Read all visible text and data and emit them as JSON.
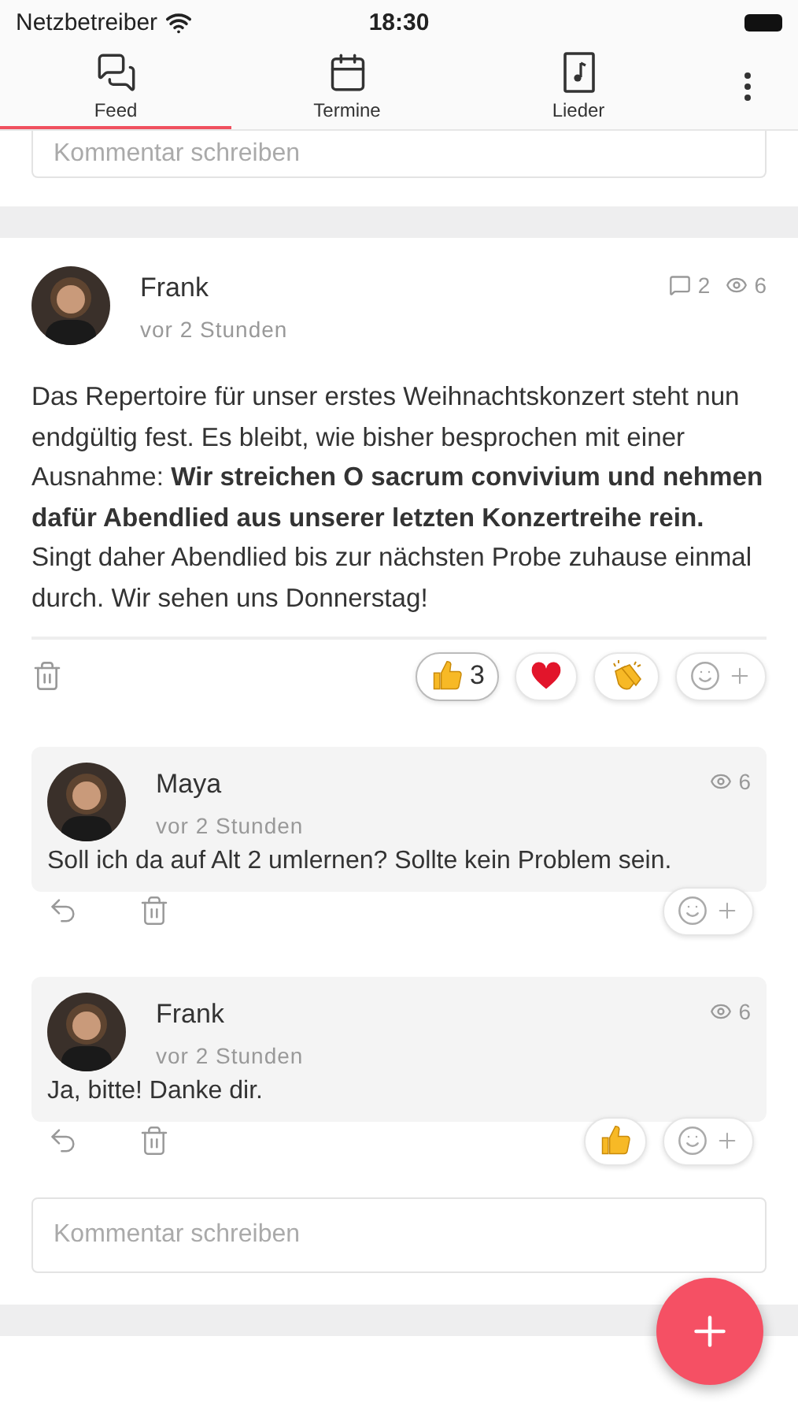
{
  "status_bar": {
    "carrier": "Netzbetreiber",
    "time": "18:30"
  },
  "tabs": [
    {
      "kind": "feed",
      "label": "Feed",
      "selected": true
    },
    {
      "kind": "calendar",
      "label": "Termine",
      "selected": false
    },
    {
      "kind": "songs",
      "label": "Lieder",
      "selected": false
    }
  ],
  "previous_post": {
    "comment_field": {
      "placeholder": "Kommentar schreiben"
    }
  },
  "post": {
    "author": "Frank",
    "time": "vor 2 Stunden",
    "comments": "2",
    "views": "6",
    "body": "Das Repertoire für unser erstes Weihnachtskonzert steht nun endgültig fest. Es bleibt, wie bisher besprochen mit einer Ausnahme: **Wir streichen O sacrum convivium und nehmen dafür Abendlied aus unserer letzten Konzertreihe rein.** Singt daher Abendlied bis zur nächsten Probe zuhause einmal durch. Wir sehen uns Donnerstag!",
    "reactions": [
      {
        "kind": "thumbs_up",
        "count": "3",
        "selected": true
      },
      {
        "kind": "heart",
        "selected": false
      },
      {
        "kind": "clap",
        "selected": false
      }
    ],
    "replies": [
      {
        "author": "Maya",
        "time": "vor 2 Stunden",
        "views": "6",
        "text": "Soll ich da auf Alt 2 umlernen? Sollte kein Problem sein."
      },
      {
        "author": "Frank",
        "time": "vor 2 Stunden",
        "views": "6",
        "text": "Ja, bitte! Danke dir.",
        "reactions": [
          {
            "kind": "thumbs_up",
            "selected": false
          }
        ]
      }
    ],
    "comment_field": {
      "placeholder": "Kommentar schreiben"
    }
  }
}
